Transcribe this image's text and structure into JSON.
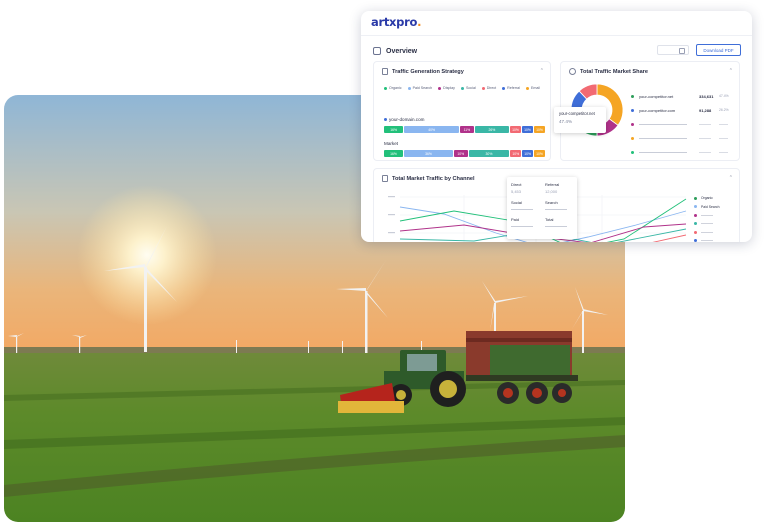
{
  "brand": {
    "name": "artxpro",
    "accent": "#2a3aa8",
    "dot_color": "#f08a1c"
  },
  "overview": {
    "title": "Overview",
    "download_label": "Download PDF"
  },
  "traffic_strategy": {
    "title": "Traffic Generation Strategy",
    "legend": [
      {
        "label": "Organic",
        "color": "#22c07a"
      },
      {
        "label": "Paid Search",
        "color": "#8ab6f0"
      },
      {
        "label": "Display",
        "color": "#b0328a"
      },
      {
        "label": "Social",
        "color": "#3ab7a6"
      },
      {
        "label": "Direct",
        "color": "#f26a73"
      },
      {
        "label": "Referral",
        "color": "#3f6ed8"
      },
      {
        "label": "Email",
        "color": "#f5a524"
      }
    ],
    "rows": [
      {
        "label": "your-domain.com",
        "segments": [
          "16%",
          "40%",
          "11%",
          "26%",
          "10%",
          "10%",
          "10%"
        ]
      },
      {
        "label": "Market",
        "segments": [
          "16%",
          "36%",
          "10%",
          "30%",
          "10%",
          "10%",
          "10%"
        ]
      }
    ]
  },
  "market_share": {
    "title": "Total Traffic Market Share",
    "tooltip": {
      "site": "your-competitor.net",
      "value": "47.4%"
    },
    "rows": [
      {
        "site": "your-competitor.net",
        "value": "334,631",
        "pct": "47.4%",
        "color": "#2e9e5b"
      },
      {
        "site": "your-competitor.com",
        "value": "91,288",
        "pct": "26.2%",
        "color": "#3f6ed8"
      },
      {
        "site": "",
        "value": "",
        "pct": "",
        "color": "#b0328a"
      },
      {
        "site": "",
        "value": "",
        "pct": "",
        "color": "#f5a524"
      },
      {
        "site": "",
        "value": "",
        "pct": "",
        "color": "#22c07a"
      }
    ],
    "donut": [
      {
        "value": 35,
        "color": "#f5a524"
      },
      {
        "value": 15,
        "color": "#b0328a"
      },
      {
        "value": 13,
        "color": "#2e9e5b"
      },
      {
        "value": 12,
        "color": "#22c07a"
      },
      {
        "value": 13,
        "color": "#3f6ed8"
      },
      {
        "value": 12,
        "color": "#f26a73"
      }
    ]
  },
  "channel": {
    "title": "Total Market Traffic by Channel",
    "tooltip": [
      {
        "label": "Direct",
        "value": "5,453"
      },
      {
        "label": "Referral",
        "value": "12,000"
      },
      {
        "label": "Social",
        "value": ""
      },
      {
        "label": "Search",
        "value": ""
      },
      {
        "label": "Paid",
        "value": ""
      },
      {
        "label": "Total",
        "value": ""
      }
    ],
    "legend": [
      {
        "label": "Organic",
        "color": "#2e9e5b"
      },
      {
        "label": "Paid Search",
        "color": "#8ab6f0"
      },
      {
        "label": "",
        "color": "#b0328a"
      },
      {
        "label": "",
        "color": "#3ab7a6"
      },
      {
        "label": "",
        "color": "#f26a73"
      },
      {
        "label": "",
        "color": "#3f6ed8"
      }
    ]
  }
}
